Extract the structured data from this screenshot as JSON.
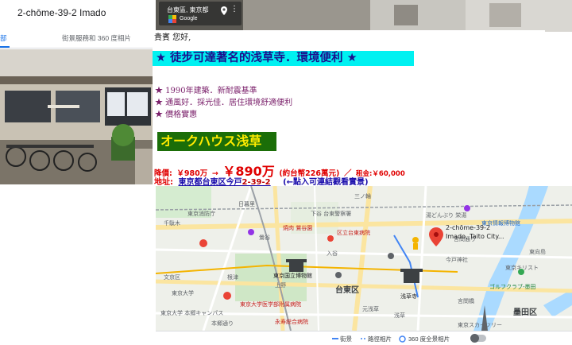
{
  "left_panel": {
    "title": "2-chōme-39-2 Imado",
    "tabs": [
      {
        "label": "部"
      },
      {
        "label": "街景服務和 360 度相片"
      }
    ]
  },
  "street_view": {
    "address": "台東區, 東京都",
    "brand": "Google"
  },
  "listing": {
    "greeting": "貴賓 您好,",
    "headline": "★ 徒步可達著名的浅草寺．環境便利 ★",
    "features": [
      "★ 1990年建築．新耐震基準",
      "★ 通風好．採光佳．居住環境舒適便利",
      "★ 價格實惠"
    ],
    "building_name": "オークハウス浅草",
    "price_label": "降價:",
    "price_old": "￥980万",
    "price_arrow": "→",
    "price_new": "￥890万",
    "price_twd": "(約台幣226萬元)",
    "price_sep": "／",
    "rent": "租金:￥60,000",
    "address_label": "地址:",
    "address_link_pre": "東京都台東区今戸",
    "address_link_num": "2-39-2",
    "address_hint": "(←點入可連結觀看實景)"
  },
  "map": {
    "pin_label_1": "2-chōme-39-2",
    "pin_label_2": "Imado, Taito City...",
    "labels": {
      "l1": "三ノ輪",
      "l2": "日暮里",
      "l3": "下谷 台東警察署",
      "l4": "東京消防庁",
      "l5": "湯どんぶり 栄湯",
      "l6": "東京情報博物館",
      "l7": "鶯谷",
      "l8": "焼肉 鶯谷園",
      "l9": "区立台東病院",
      "l10": "言問通り",
      "l11": "入谷",
      "l12": "千駄木",
      "l13": "東京国立博物館",
      "l14": "上野",
      "l15": "台東区",
      "l16": "浅草寺",
      "l17": "東京大学医学部附属病院",
      "l18": "永寿総合病院",
      "l19": "墨田区",
      "l20": "東京スカイツリー",
      "l21": "文京区",
      "l22": "根津",
      "l23": "東京大学",
      "l24": "今戸神社",
      "l25": "ゴルフクラブ-墨田",
      "l26": "東京キリスト",
      "l27": "元浅草",
      "l28": "浅草",
      "l29": "言問橋",
      "l30": "東向島",
      "l31": "本郷通り",
      "l32": "東京大学 本郷キャンパス"
    },
    "bottom_bar": {
      "street": "街景",
      "route": "路徑相片",
      "sv360": "360 度全景相片"
    }
  }
}
